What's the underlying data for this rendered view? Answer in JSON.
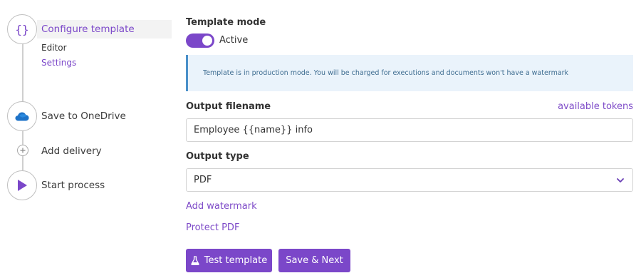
{
  "colors": {
    "accent": "#7b47c9",
    "link": "#7e4bc8",
    "info_background": "#eaf3fb",
    "info_border": "#4a90c9",
    "onedrive_blue": "#1e73c8"
  },
  "workflow": {
    "steps": [
      {
        "icon": "curly-braces-icon",
        "label": "Configure template",
        "sub_items": [
          "Editor",
          "Settings"
        ]
      },
      {
        "icon": "onedrive-cloud-icon",
        "label": "Save to OneDrive"
      },
      {
        "icon": "plus-icon",
        "label": "Add delivery"
      },
      {
        "icon": "play-icon",
        "label": "Start process"
      }
    ]
  },
  "form": {
    "template_mode_label": "Template mode",
    "toggle_state_label": "Active",
    "toggle_on": true,
    "info_message": "Template is in production mode. You will be charged for executions and documents won't have a watermark",
    "output_filename_label": "Output filename",
    "available_tokens_link": "available tokens",
    "output_filename_value": "Employee {{name}} info",
    "output_type_label": "Output type",
    "output_type_value": "PDF",
    "add_watermark_link": "Add watermark",
    "protect_pdf_link": "Protect PDF",
    "test_button_icon": "flask-icon",
    "test_button_label": "Test template",
    "save_next_button_label": "Save & Next"
  }
}
